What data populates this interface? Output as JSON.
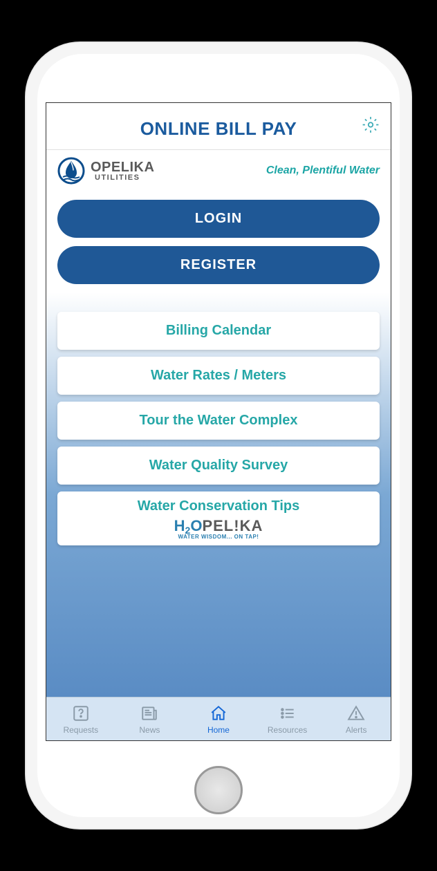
{
  "header": {
    "title": "ONLINE BILL PAY"
  },
  "brand": {
    "name": "OPELIKA",
    "subname": "UTILITIES",
    "tagline": "Clean, Plentiful Water"
  },
  "auth": {
    "login_label": "LOGIN",
    "register_label": "REGISTER"
  },
  "links": [
    {
      "label": "Billing Calendar"
    },
    {
      "label": "Water Rates / Meters"
    },
    {
      "label": "Tour the Water Complex"
    },
    {
      "label": "Water Quality Survey"
    },
    {
      "label": "Water Conservation Tips"
    }
  ],
  "sublogo": {
    "h": "H",
    "two": "2",
    "o": "O",
    "pelika": "PEL!KA",
    "tag": "WATER WISDOM... ON TAP!"
  },
  "tabs": [
    {
      "label": "Requests",
      "key": "requests"
    },
    {
      "label": "News",
      "key": "news"
    },
    {
      "label": "Home",
      "key": "home"
    },
    {
      "label": "Resources",
      "key": "resources"
    },
    {
      "label": "Alerts",
      "key": "alerts"
    }
  ],
  "active_tab": "home"
}
